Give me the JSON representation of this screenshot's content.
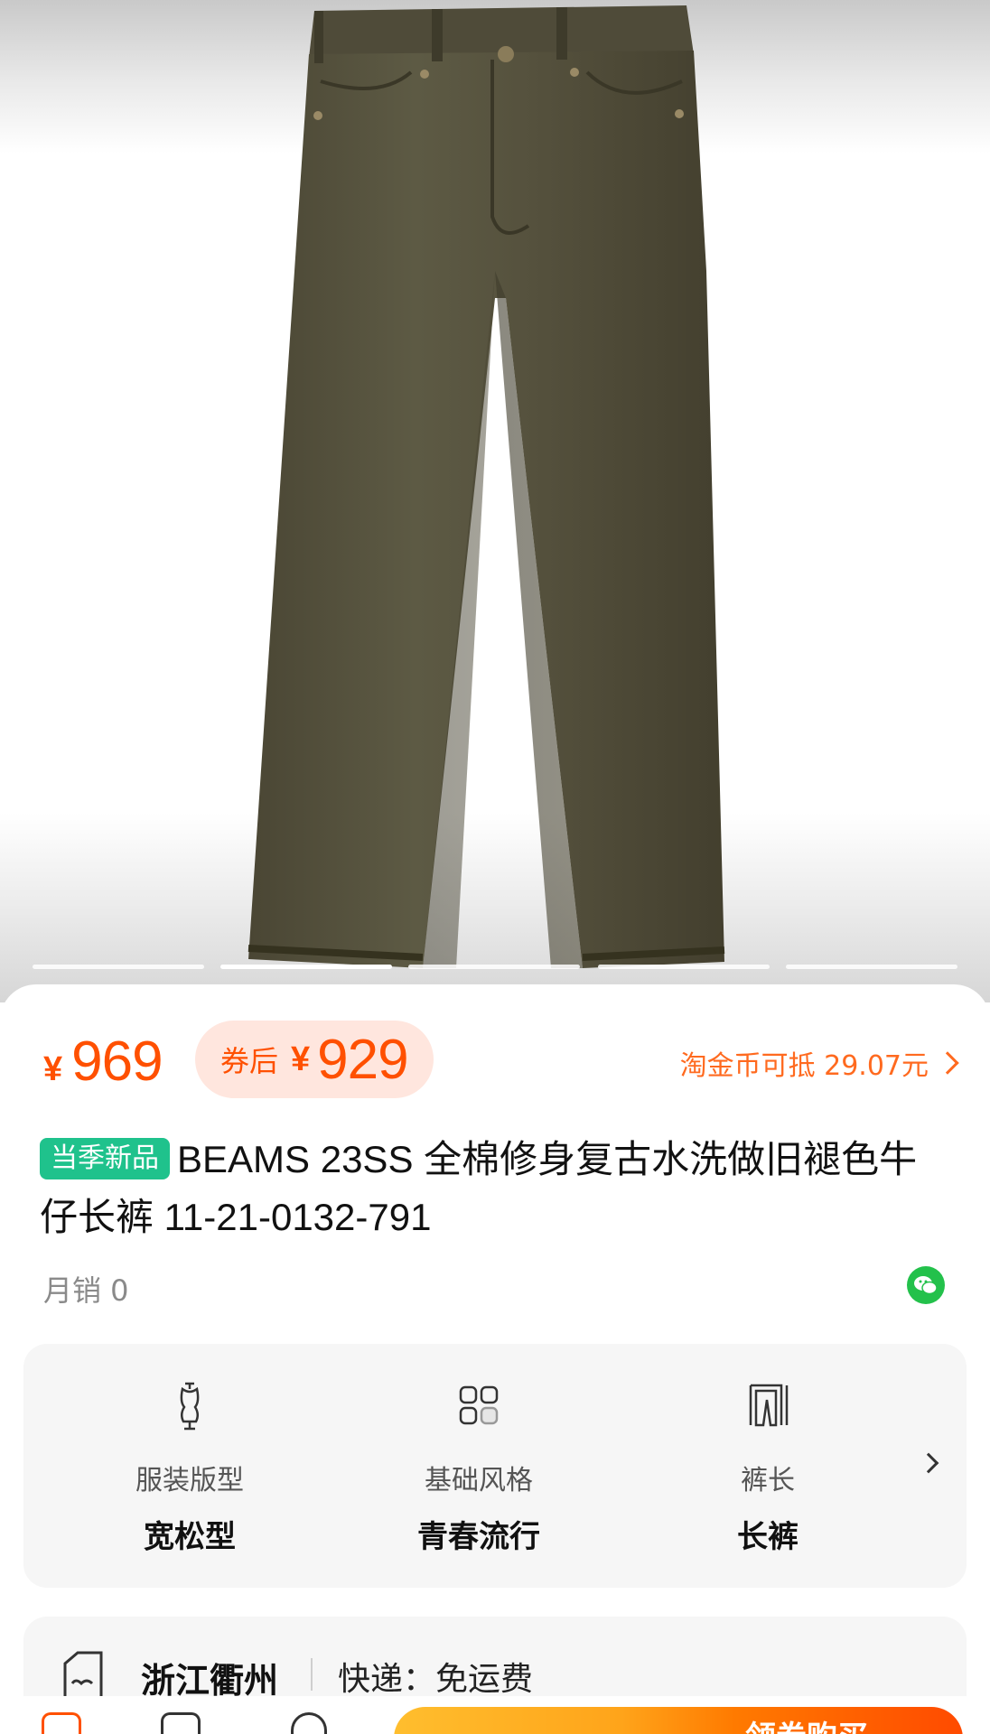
{
  "gallery": {
    "image": "denim-jeans-product-photo",
    "pages": 5,
    "active_index": 1
  },
  "price": {
    "currency": "¥",
    "current": "969",
    "coupon_label": "券后",
    "coupon_price": "929",
    "coin_text": "淘金币可抵 29.07元"
  },
  "product": {
    "tag": "当季新品",
    "title": "BEAMS 23SS 全棉修身复古水洗做旧褪色牛仔长裤 11-21-0132-791",
    "sales": "月销 0"
  },
  "attributes": [
    {
      "icon": "dress-form-icon",
      "label": "服装版型",
      "value": "宽松型"
    },
    {
      "icon": "grid-icon",
      "label": "基础风格",
      "value": "青春流行"
    },
    {
      "icon": "pants-length-icon",
      "label": "裤长",
      "value": "长裤"
    }
  ],
  "shipping": {
    "city": "浙江衢州",
    "method": "快递：免运费"
  },
  "bottom_bar": {
    "cta_label": "领券购买"
  },
  "colors": {
    "accent": "#ff5000",
    "tag_green": "#1fc28c",
    "wechat_green": "#23c14b"
  }
}
